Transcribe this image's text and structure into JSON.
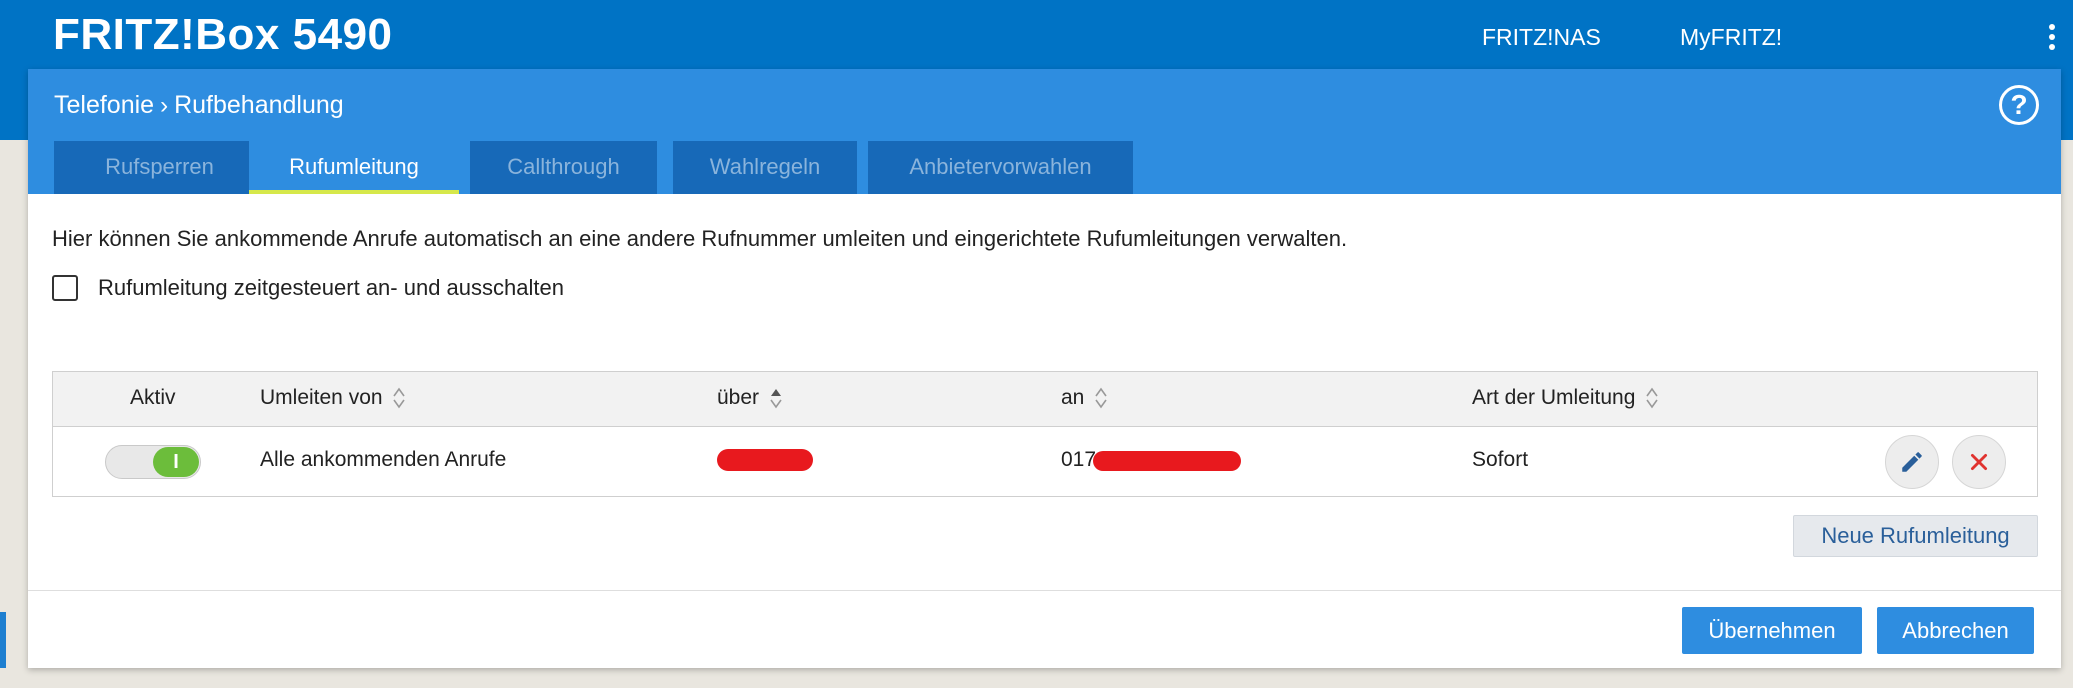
{
  "header": {
    "brand": "FRITZ!Box 5490",
    "links": [
      "FRITZ!NAS",
      "MyFRITZ!"
    ]
  },
  "breadcrumb": {
    "parent": "Telefonie",
    "current": "Rufbehandlung"
  },
  "help_label": "?",
  "tabs": [
    {
      "label": "Rufsperren",
      "active": false
    },
    {
      "label": "Rufumleitung",
      "active": true
    },
    {
      "label": "Callthrough",
      "active": false
    },
    {
      "label": "Wahlregeln",
      "active": false
    },
    {
      "label": "Anbietervorwahlen",
      "active": false
    }
  ],
  "content": {
    "description": "Hier können Sie ankommende Anrufe automatisch an eine andere Rufnummer umleiten und eingerichtete Rufumleitungen verwalten.",
    "timed_checkbox_label": "Rufumleitung zeitgesteuert an- und ausschalten",
    "timed_checkbox_checked": false
  },
  "table": {
    "columns": [
      "Aktiv",
      "Umleiten von",
      "über",
      "an",
      "Art der Umleitung"
    ],
    "sorted_column": "über",
    "rows": [
      {
        "active": true,
        "toggle_label": "I",
        "from": "Alle ankommenden Anrufe",
        "via": "",
        "to": "017",
        "type": "Sofort"
      }
    ]
  },
  "buttons": {
    "new_forwarding": "Neue Rufumleitung",
    "apply": "Übernehmen",
    "cancel": "Abbrechen"
  },
  "colors": {
    "header_blue": "#0073c5",
    "panel_blue": "#2e8de0",
    "tab_active_underline": "#d6e84a",
    "toggle_on": "#6cbd3b",
    "delete_red": "#e0332f"
  }
}
